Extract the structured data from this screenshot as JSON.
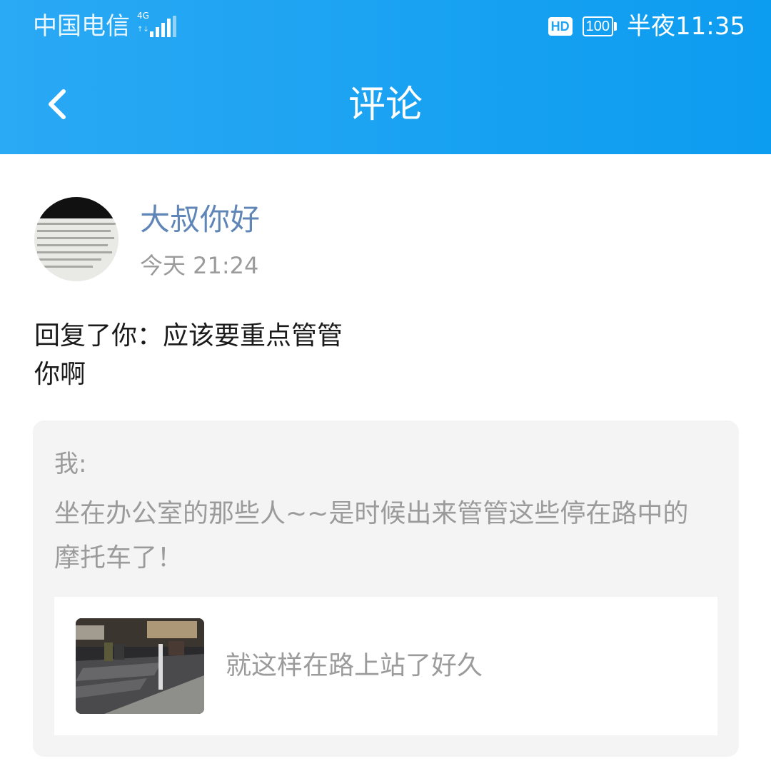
{
  "status_bar": {
    "carrier": "中国电信",
    "network_type": "4G",
    "network_arrows": "↑↓",
    "hd_badge": "HD",
    "battery_level": "100",
    "time": "半夜11:35"
  },
  "header": {
    "title": "评论",
    "back_icon": "chevron-left-icon",
    "background_color": "#1ea4f3"
  },
  "comment": {
    "username": "大叔你好",
    "time": "今天 21:24",
    "reply_text": "回复了你：应该要重点管管你啊",
    "username_color": "#5f86b6"
  },
  "quote": {
    "author": "我:",
    "text": "坐在办公室的那些人~~是时候出来管管这些停在路中的摩托车了！"
  },
  "linked_post": {
    "title": "就这样在路上站了好久"
  }
}
